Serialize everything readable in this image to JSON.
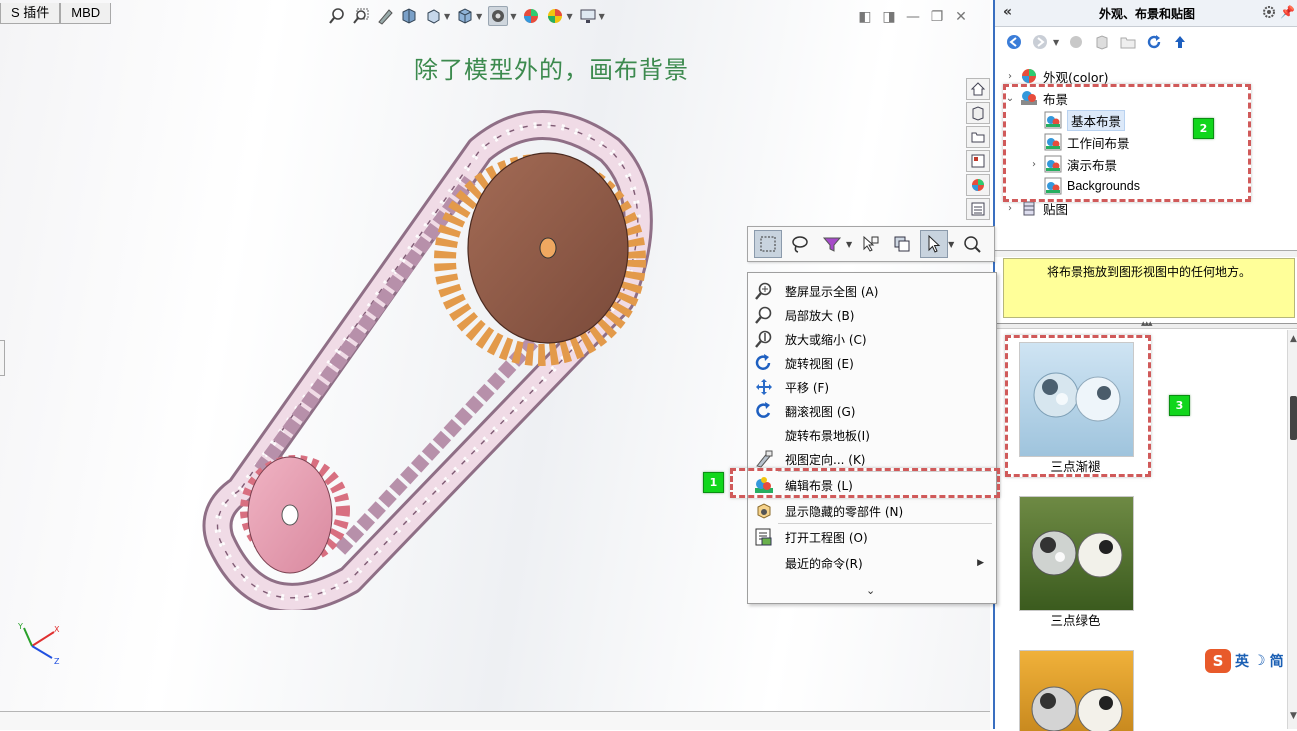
{
  "doc_tabs": [
    "S 插件",
    "MBD"
  ],
  "annotation_text": "除了模型外的，画布背景",
  "task_pane": {
    "title": "外观、布景和贴图",
    "tree": [
      {
        "label": "外观(color)",
        "expand": "›"
      },
      {
        "label": "布景",
        "expand": "⌄"
      },
      {
        "label": "基本布景",
        "expand": ""
      },
      {
        "label": "工作间布景",
        "expand": ""
      },
      {
        "label": "演示布景",
        "expand": "›"
      },
      {
        "label": "Backgrounds",
        "expand": ""
      },
      {
        "label": "贴图",
        "expand": "›"
      }
    ],
    "hint": "将布景拖放到图形视图中的任何地方。",
    "scenes": [
      "三点渐褪",
      "三点绿色",
      ""
    ]
  },
  "context_menu": {
    "items": [
      {
        "label": "整屏显示全图 (A)",
        "icon": "zoom-fit-icon"
      },
      {
        "label": "局部放大 (B)",
        "icon": "zoom-area-icon"
      },
      {
        "label": "放大或缩小 (C)",
        "icon": "zoom-in-out-icon"
      },
      {
        "label": "旋转视图 (E)",
        "icon": "rotate-icon"
      },
      {
        "label": "平移 (F)",
        "icon": "pan-icon"
      },
      {
        "label": "翻滚视图 (G)",
        "icon": "roll-icon"
      },
      {
        "label": "旋转布景地板(I)",
        "icon": ""
      },
      {
        "label": "视图定向... (K)",
        "icon": "view-orientation-icon"
      },
      {
        "label": "编辑布景 (L)",
        "icon": "edit-scene-icon"
      },
      {
        "label": "显示隐藏的零部件 (N)",
        "icon": "show-hidden-icon"
      },
      {
        "label": "打开工程图 (O)",
        "icon": "open-drawing-icon"
      },
      {
        "label": "最近的命令(R)",
        "icon": ""
      }
    ],
    "more": "⌄"
  },
  "callouts": [
    "1",
    "2",
    "3"
  ],
  "ime": {
    "logo": "S",
    "mode": "英",
    "moon": "☽",
    "charset": "简"
  },
  "triad": {
    "x": "X",
    "y": "Y",
    "z": "Z"
  },
  "colors": {
    "accent": "#3a6fc0",
    "callout": "#11d61c",
    "dash": "#d05a5a",
    "hint_bg": "#ffff99"
  }
}
